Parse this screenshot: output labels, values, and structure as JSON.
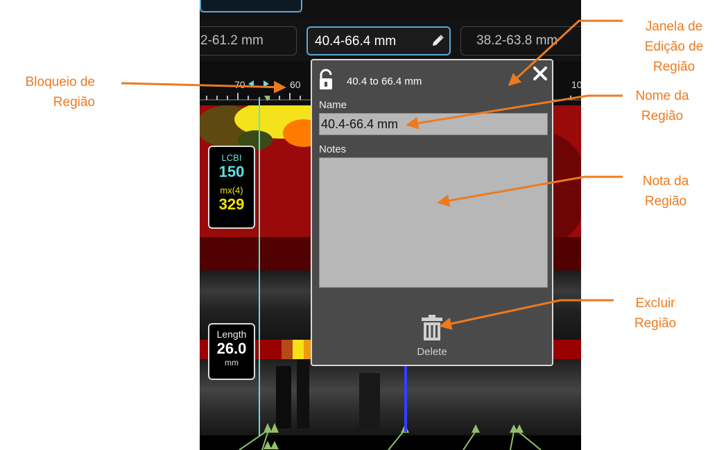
{
  "region_tabs": [
    {
      "label": "2-61.2 mm",
      "active": false
    },
    {
      "label": "40.4-66.4 mm",
      "active": true
    },
    {
      "label": "38.2-63.8 mm",
      "active": false
    }
  ],
  "ruler": {
    "labels": [
      "70",
      "60",
      "10"
    ]
  },
  "metrics": {
    "lcbi_label": "LCBI",
    "lcbi_value": "150",
    "mx_label": "mx(4)",
    "mx_value": "329",
    "length_label": "Length",
    "length_value": "26.0",
    "length_unit": "mm"
  },
  "dialog": {
    "range_text": "40.4 to 66.4 mm",
    "name_label": "Name",
    "name_value": "40.4-66.4 mm",
    "notes_label": "Notes",
    "notes_value": "",
    "delete_label": "Delete"
  },
  "annotations": {
    "lock": [
      "Bloqueio de",
      "Região"
    ],
    "edit_window": [
      "Janela de",
      "Edição de",
      "Região"
    ],
    "region_name": [
      "Nome da",
      "Região"
    ],
    "region_note": [
      "Nota da",
      "Região"
    ],
    "delete_region": [
      "Excluir",
      "Região"
    ]
  },
  "colors": {
    "annotation": "#ee7a1e",
    "accent": "#5aa8d8",
    "lcbi": "#5ee0e0",
    "mx": "#f2e600"
  }
}
